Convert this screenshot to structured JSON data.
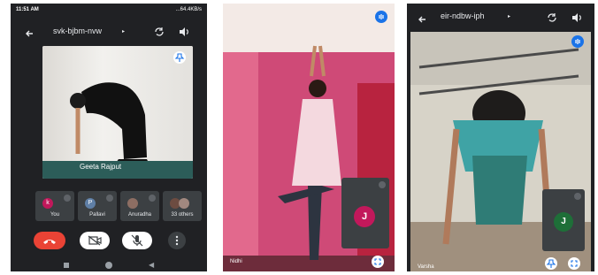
{
  "panel1": {
    "status": {
      "time": "11:51 AM",
      "right": "...64.4KB/s"
    },
    "meeting_code": "svk-bjbm-nvw",
    "tile_name": "Geeta Rajput",
    "participants": [
      {
        "label": "You",
        "initial": "k",
        "color": "#c2185b"
      },
      {
        "label": "Pallavi",
        "initial": "P",
        "color": "#5f7fa6"
      },
      {
        "label": "Anuradha",
        "initial": "",
        "color": "#8d6e63"
      },
      {
        "label": "33 others",
        "initial": "",
        "color": "#6d4c41"
      }
    ]
  },
  "panel2": {
    "name": "Nidhi",
    "pip_initial": "J"
  },
  "panel3": {
    "meeting_code": "eir-ndbw-iph",
    "name": "Varsha",
    "pip_initial": "J"
  },
  "icons": [
    "back-arrow-icon",
    "camera-flip-icon",
    "speaker-icon",
    "pin-icon",
    "mic-off-icon",
    "end-call-icon",
    "camera-off-icon",
    "more-icon",
    "fullscreen-icon",
    "audio-indicator-icon"
  ]
}
